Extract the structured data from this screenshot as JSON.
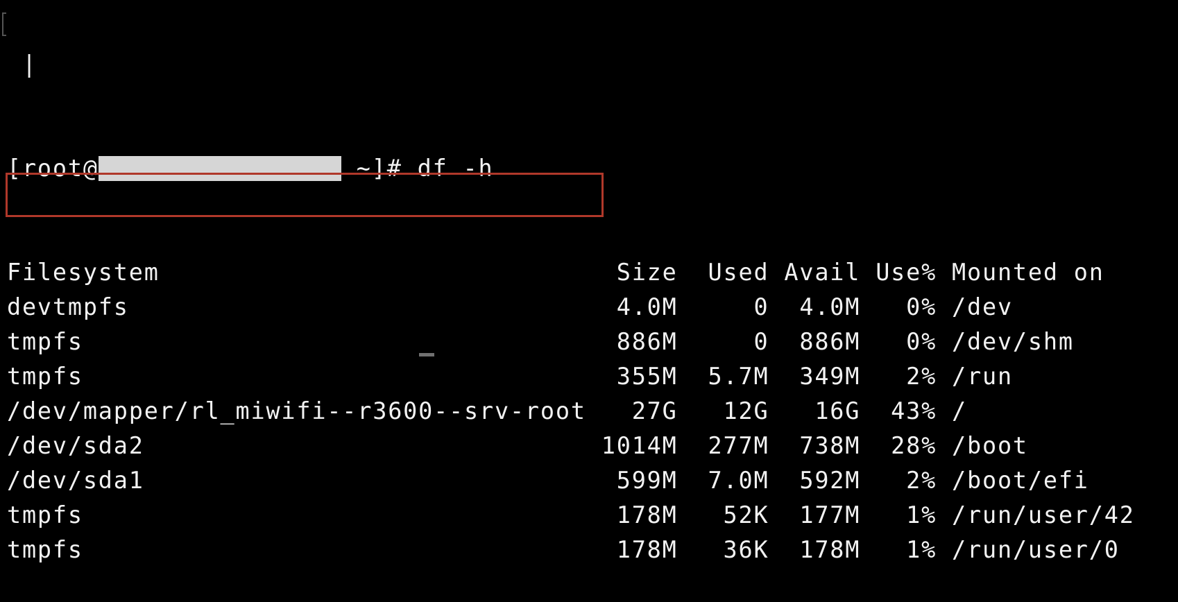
{
  "terminal": {
    "prev_line": " |",
    "prompt": {
      "prefix": "[root@",
      "hostname_redacted": true,
      "suffix": " ~]# ",
      "command": "df -h"
    },
    "table": {
      "headers": [
        "Filesystem",
        "Size",
        "Used",
        "Avail",
        "Use%",
        "Mounted on"
      ],
      "rows": [
        {
          "filesystem": "devtmpfs",
          "size": "4.0M",
          "used": "0",
          "avail": "4.0M",
          "use_pct": "0%",
          "mounted_on": "/dev"
        },
        {
          "filesystem": "tmpfs",
          "size": "886M",
          "used": "0",
          "avail": "886M",
          "use_pct": "0%",
          "mounted_on": "/dev/shm"
        },
        {
          "filesystem": "tmpfs",
          "size": "355M",
          "used": "5.7M",
          "avail": "349M",
          "use_pct": "2%",
          "mounted_on": "/run"
        },
        {
          "filesystem": "/dev/mapper/rl_miwifi--r3600--srv-root",
          "size": "27G",
          "used": "12G",
          "avail": "16G",
          "use_pct": "43%",
          "mounted_on": "/",
          "highlighted": true
        },
        {
          "filesystem": "/dev/sda2",
          "size": "1014M",
          "used": "277M",
          "avail": "738M",
          "use_pct": "28%",
          "mounted_on": "/boot"
        },
        {
          "filesystem": "/dev/sda1",
          "size": "599M",
          "used": "7.0M",
          "avail": "592M",
          "use_pct": "2%",
          "mounted_on": "/boot/efi"
        },
        {
          "filesystem": "tmpfs",
          "size": "178M",
          "used": "52K",
          "avail": "177M",
          "use_pct": "1%",
          "mounted_on": "/run/user/42"
        },
        {
          "filesystem": "tmpfs",
          "size": "178M",
          "used": "36K",
          "avail": "178M",
          "use_pct": "1%",
          "mounted_on": "/run/user/0"
        }
      ]
    },
    "highlight_color": "#b0382a",
    "redaction_color": "#d6d6d6"
  }
}
